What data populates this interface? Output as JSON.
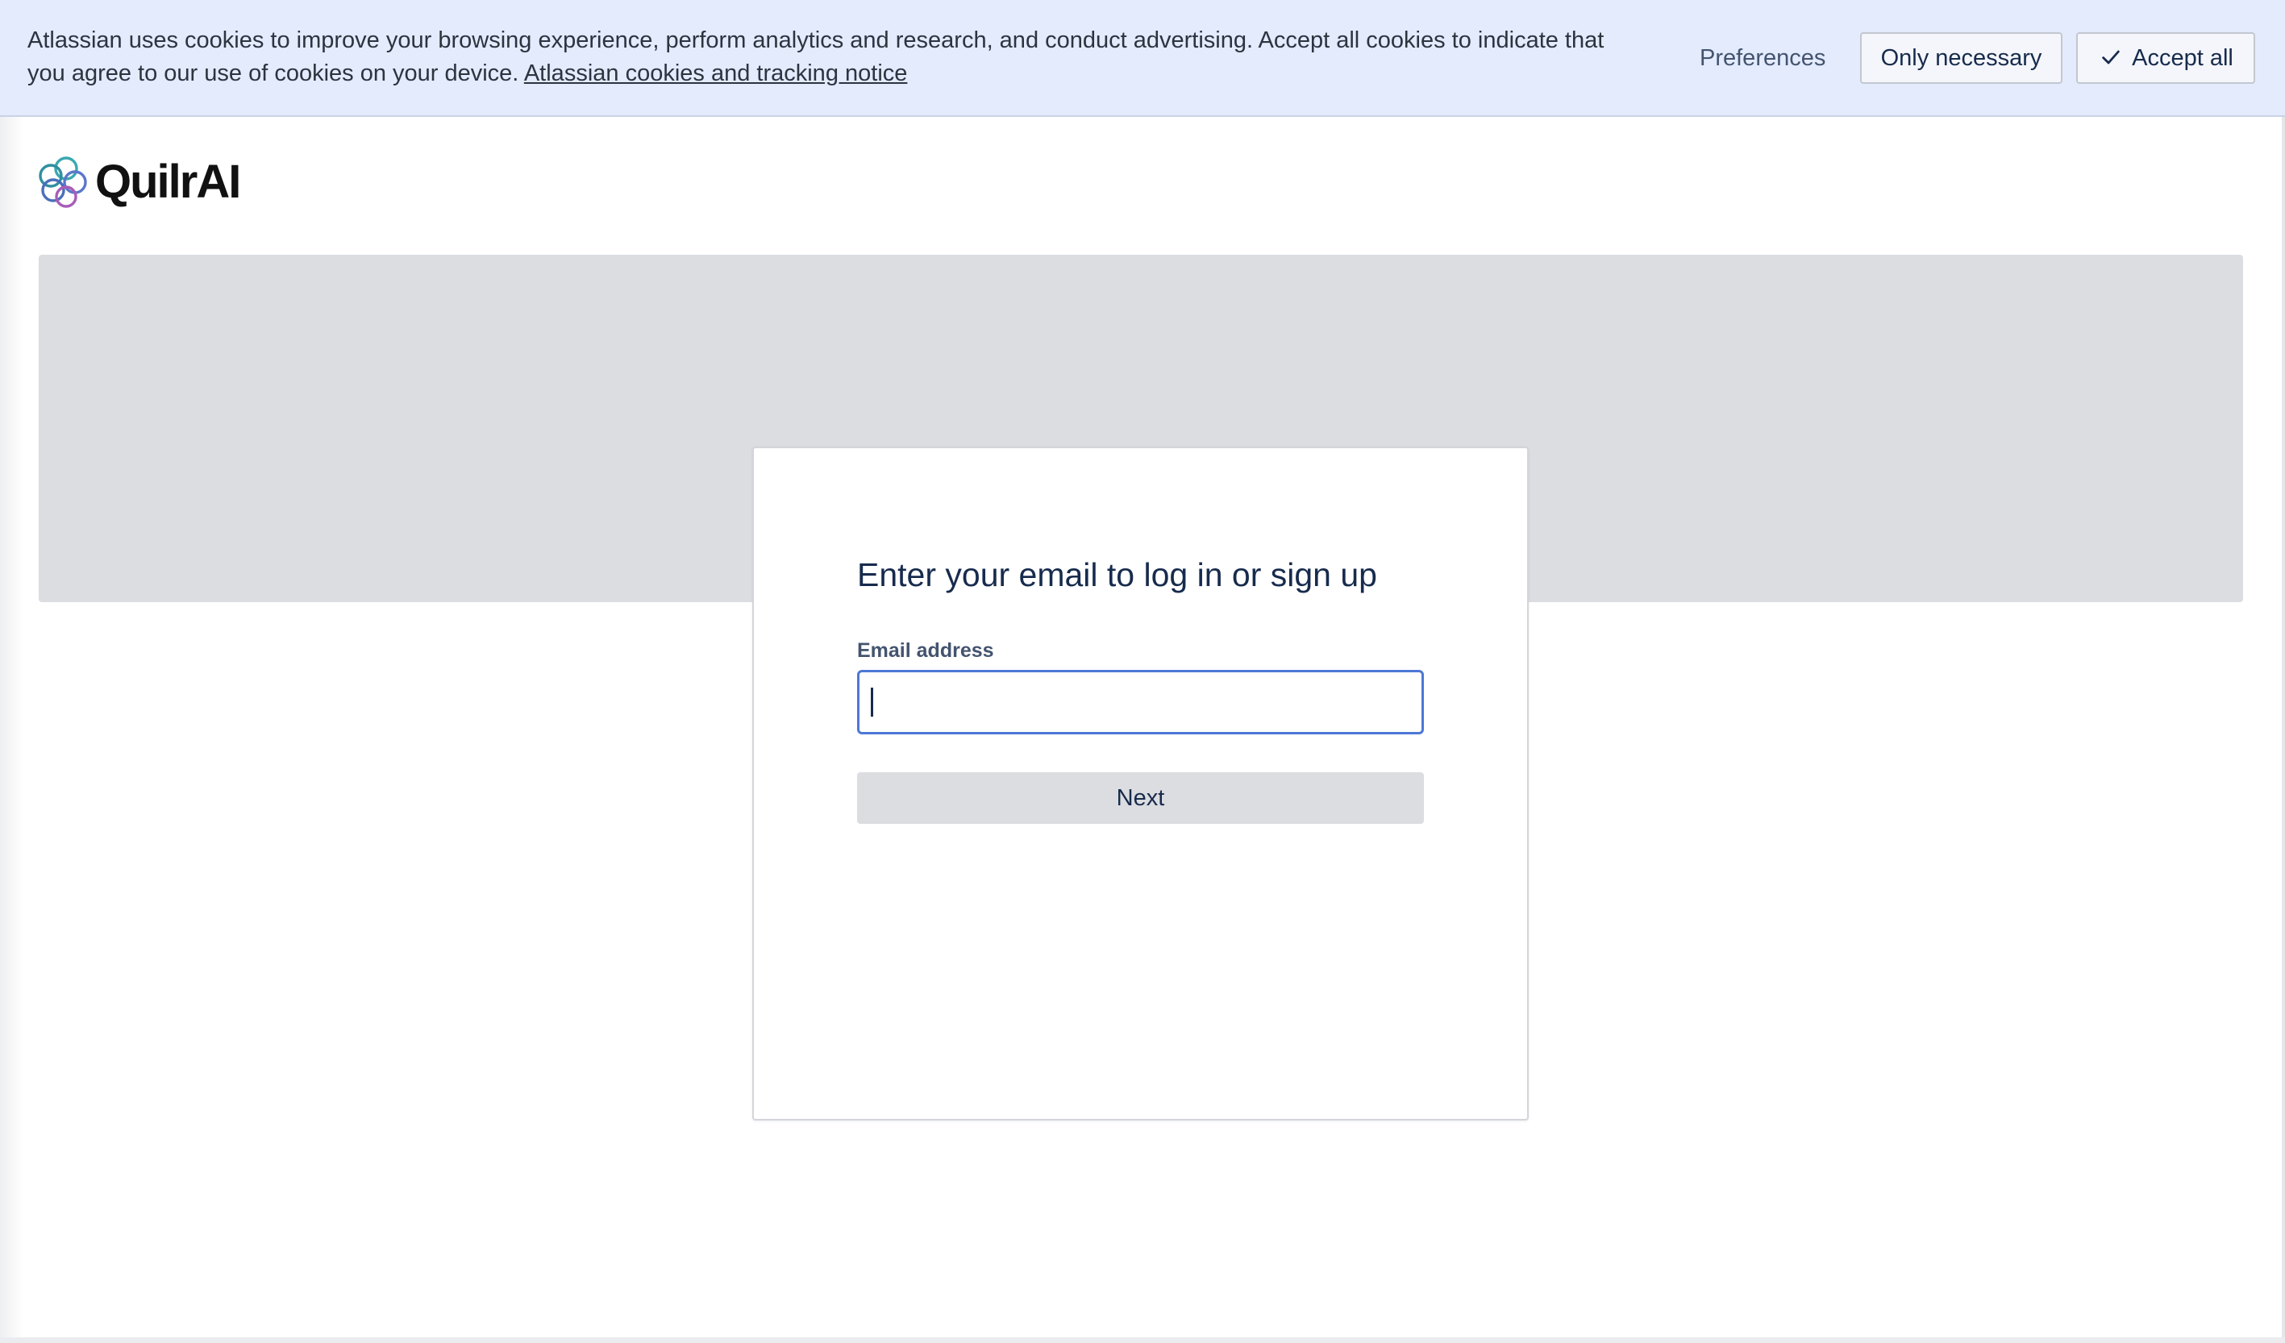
{
  "cookie_banner": {
    "message": "Atlassian uses cookies to improve your browsing experience, perform analytics and research, and conduct advertising. Accept all cookies to indicate that you agree to our use of cookies on your device.",
    "link_text": "Atlassian cookies and tracking notice",
    "preferences_label": "Preferences",
    "only_necessary_label": "Only necessary",
    "accept_all_label": "Accept all"
  },
  "header": {
    "logo_text": "QuilrAI"
  },
  "login": {
    "title": "Enter your email to log in or sign up",
    "email_label": "Email address",
    "email_value": "",
    "next_label": "Next"
  },
  "colors": {
    "banner_bg": "#e3ebfd",
    "hero_bg": "#dcdde1",
    "input_focus_border": "#4c78d6",
    "text_primary": "#172b4d"
  },
  "icons": {
    "accept_check": "check-icon",
    "logo": "quilrai-logo-icon"
  }
}
